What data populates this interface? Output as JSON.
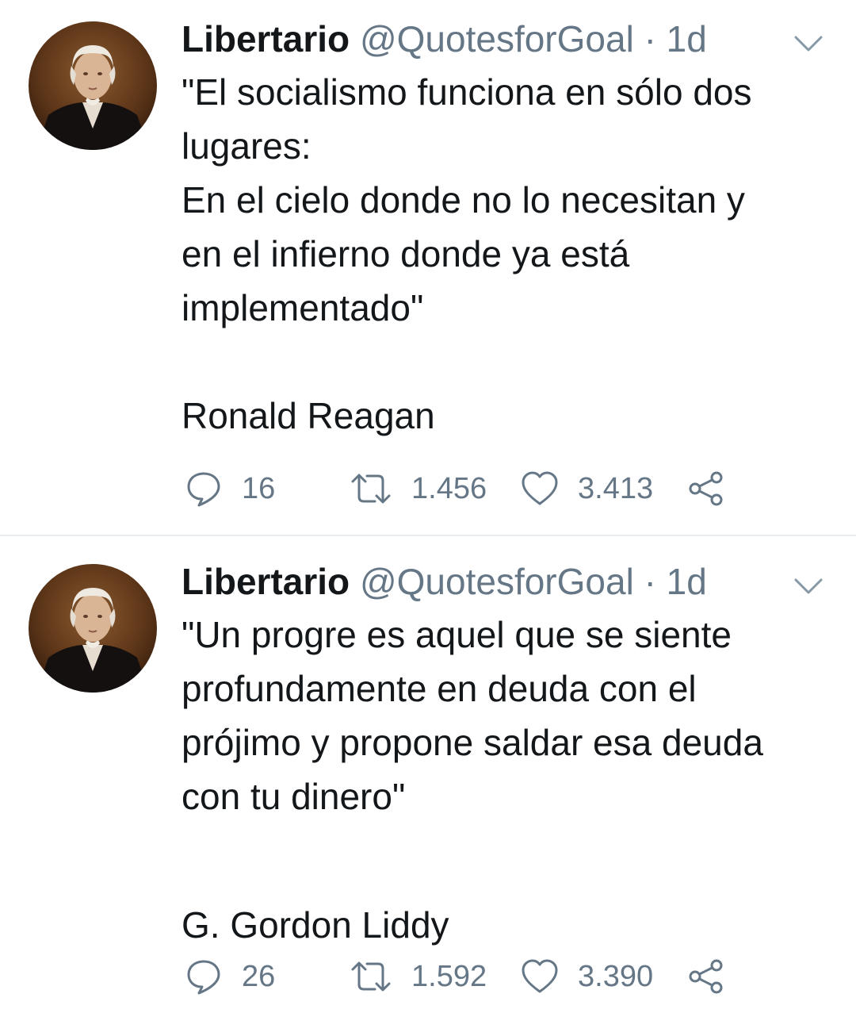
{
  "colors": {
    "text": "#14171a",
    "secondary": "#657786",
    "divider": "#e6ecf0",
    "background": "#ffffff"
  },
  "tweets": [
    {
      "name": "Libertario",
      "handle": "@QuotesforGoal",
      "time": "· 1d",
      "avatar_icon": "portrait-avatar",
      "lines": [
        "\"El socialismo funciona en sólo dos",
        "lugares:",
        "En el cielo donde no lo necesitan y",
        "en el infierno donde ya está",
        "implementado\"",
        "",
        "Ronald Reagan"
      ],
      "replies": "16",
      "retweets": "1.456",
      "likes": "3.413"
    },
    {
      "name": "Libertario",
      "handle": "@QuotesforGoal",
      "time": "· 1d",
      "avatar_icon": "portrait-avatar",
      "lines": [
        "\"Un progre es aquel que se siente",
        "profundamente en deuda con el",
        "prójimo y propone saldar esa deuda",
        "con tu dinero\"",
        "",
        "G. Gordon Liddy"
      ],
      "replies": "26",
      "retweets": "1.592",
      "likes": "3.390"
    }
  ]
}
